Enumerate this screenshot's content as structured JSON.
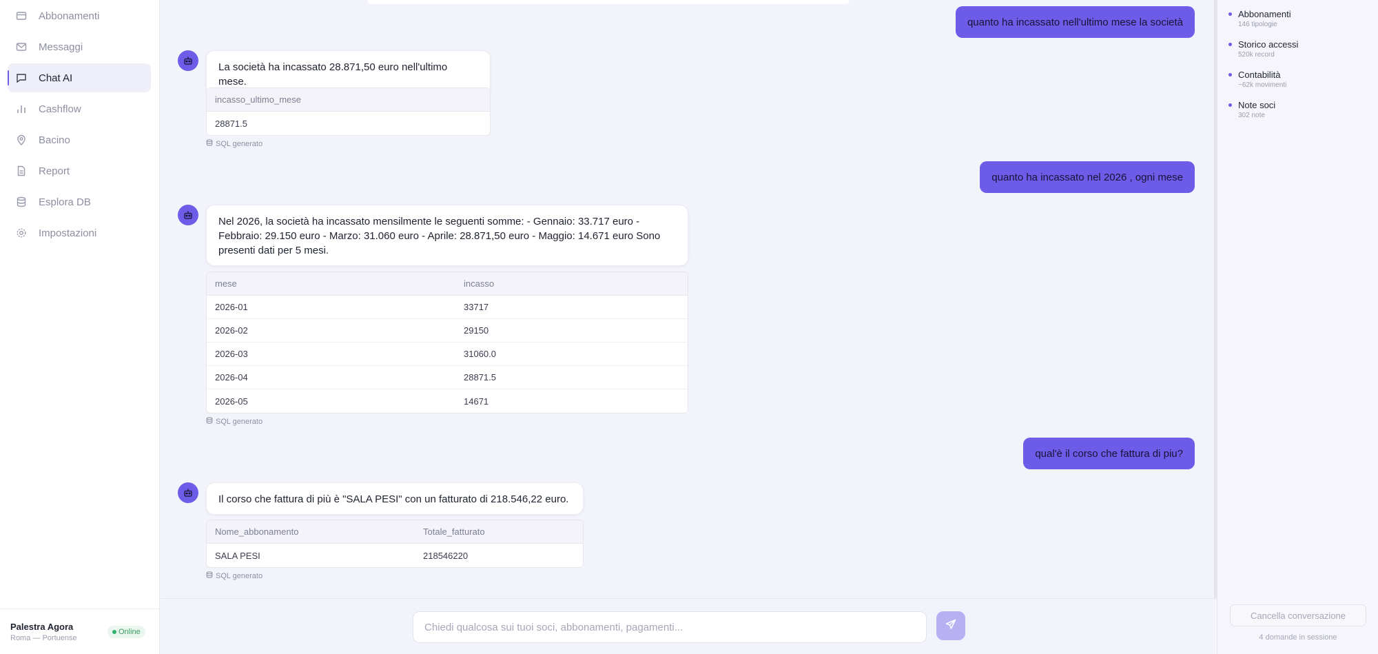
{
  "sidebar": {
    "items": [
      {
        "label": "Abbonamenti",
        "icon": "card-icon"
      },
      {
        "label": "Messaggi",
        "icon": "mail-icon"
      },
      {
        "label": "Chat AI",
        "icon": "chat-icon",
        "active": true
      },
      {
        "label": "Cashflow",
        "icon": "bar-chart-icon"
      },
      {
        "label": "Bacino",
        "icon": "map-pin-icon"
      },
      {
        "label": "Report",
        "icon": "document-icon"
      },
      {
        "label": "Esplora DB",
        "icon": "database-icon"
      },
      {
        "label": "Impostazioni",
        "icon": "gear-icon"
      }
    ],
    "footer": {
      "name": "Palestra Agora",
      "location": "Roma — Portuense",
      "status": "Online"
    }
  },
  "chat": {
    "messages": [
      {
        "role": "user",
        "text": "quanto ha incassato nell'ultimo mese la società"
      },
      {
        "role": "assistant",
        "text": "La società ha incassato 28.871,50 euro nell'ultimo mese.",
        "table": {
          "columns": [
            "incasso_ultimo_mese"
          ],
          "rows": [
            [
              "28871.5"
            ]
          ]
        },
        "sql_label": "SQL generato"
      },
      {
        "role": "user",
        "text": "quanto ha incassato nel 2026 , ogni mese"
      },
      {
        "role": "assistant",
        "text": "Nel 2026, la società ha incassato mensilmente le seguenti somme: - Gennaio: 33.717 euro - Febbraio: 29.150 euro - Marzo: 31.060 euro - Aprile: 28.871,50 euro - Maggio: 14.671 euro Sono presenti dati per 5 mesi.",
        "table": {
          "columns": [
            "mese",
            "incasso"
          ],
          "rows": [
            [
              "2026-01",
              "33717"
            ],
            [
              "2026-02",
              "29150"
            ],
            [
              "2026-03",
              "31060.0"
            ],
            [
              "2026-04",
              "28871.5"
            ],
            [
              "2026-05",
              "14671"
            ]
          ]
        },
        "sql_label": "SQL generato"
      },
      {
        "role": "user",
        "text": "qual'è il corso che fattura di piu?"
      },
      {
        "role": "assistant",
        "text": "Il corso che fattura di più è \"SALA PESI\" con un fatturato di 218.546,22 euro.",
        "table": {
          "columns": [
            "Nome_abbonamento",
            "Totale_fatturato"
          ],
          "rows": [
            [
              "SALA PESI",
              "218546220"
            ]
          ]
        },
        "sql_label": "SQL generato"
      }
    ]
  },
  "composer": {
    "placeholder": "Chiedi qualcosa sui tuoi soci, abbonamenti, pagamenti..."
  },
  "right_panel": {
    "sources": [
      {
        "name": "Abbonamenti",
        "meta": "146 tipologie"
      },
      {
        "name": "Storico accessi",
        "meta": "520k record"
      },
      {
        "name": "Contabilità",
        "meta": "~62k movimenti"
      },
      {
        "name": "Note soci",
        "meta": "302 note"
      }
    ],
    "clear_label": "Cancella conversazione",
    "session_count": "4 domande in sessione"
  },
  "colors": {
    "accent": "#6c5ce7",
    "accent_light": "#b7b1f2",
    "online": "#2fb36b",
    "background": "#f3f3fb"
  }
}
